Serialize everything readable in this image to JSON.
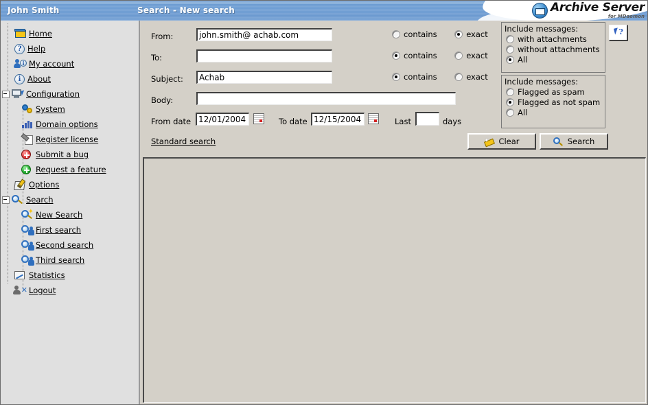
{
  "header": {
    "user": "John Smith",
    "title": "Search - New search",
    "logo_main": "Archive Server",
    "logo_sub": "for MDaemon",
    "logo_icon": "archive-mail-icon"
  },
  "sidebar": {
    "items": [
      {
        "label": "Home",
        "icon": "home-icon",
        "level": 0,
        "toggle": "none"
      },
      {
        "label": "Help",
        "icon": "help-question-icon",
        "level": 0,
        "toggle": "none"
      },
      {
        "label": "My account",
        "icon": "user-info-icon",
        "level": 0,
        "toggle": "none"
      },
      {
        "label": "About",
        "icon": "info-icon",
        "level": 0,
        "toggle": "none"
      },
      {
        "label": "Configuration",
        "icon": "computer-icon",
        "level": 0,
        "toggle": "minus"
      },
      {
        "label": "System",
        "icon": "gears-icon",
        "level": 1,
        "toggle": "none"
      },
      {
        "label": "Domain options",
        "icon": "bar-chart-icon",
        "level": 1,
        "toggle": "none"
      },
      {
        "label": "Register license",
        "icon": "license-pen-icon",
        "level": 1,
        "toggle": "none"
      },
      {
        "label": "Submit a bug",
        "icon": "plus-red-icon",
        "level": 1,
        "toggle": "none"
      },
      {
        "label": "Request a feature",
        "icon": "plus-green-icon",
        "level": 1,
        "toggle": "none"
      },
      {
        "label": "Options",
        "icon": "options-pencil-icon",
        "level": 0,
        "toggle": "none"
      },
      {
        "label": "Search",
        "icon": "magnifier-icon",
        "level": 0,
        "toggle": "minus"
      },
      {
        "label": "New Search",
        "icon": "new-search-icon",
        "level": 1,
        "toggle": "none"
      },
      {
        "label": "First search",
        "icon": "user-search-icon",
        "level": 1,
        "toggle": "none"
      },
      {
        "label": "Second search",
        "icon": "user-search-icon",
        "level": 1,
        "toggle": "none"
      },
      {
        "label": "Third search",
        "icon": "user-search-icon",
        "level": 1,
        "toggle": "none"
      },
      {
        "label": "Statistics",
        "icon": "statistics-icon",
        "level": 0,
        "toggle": "none"
      },
      {
        "label": "Logout",
        "icon": "logout-icon",
        "level": 0,
        "toggle": "none"
      }
    ]
  },
  "form": {
    "fields": {
      "from": {
        "label": "From:",
        "value": "john.smith@ achab.com",
        "placeholder": ""
      },
      "to": {
        "label": "To:",
        "value": "",
        "placeholder": ""
      },
      "subject": {
        "label": "Subject:",
        "value": "Achab",
        "placeholder": ""
      },
      "body": {
        "label": "Body:",
        "value": "",
        "placeholder": ""
      }
    },
    "match_options": {
      "contains_label": "contains",
      "exact_label": "exact",
      "rows": [
        {
          "field": "from",
          "selected": "exact"
        },
        {
          "field": "to",
          "selected": "contains"
        },
        {
          "field": "subject",
          "selected": "contains"
        }
      ]
    },
    "dates": {
      "from_label": "From date",
      "from_value": "12/01/2004",
      "to_label": "To date",
      "to_value": "12/15/2004",
      "calendar_icon": "calendar-icon"
    },
    "last_days": {
      "prefix_label": "Last",
      "value": "",
      "suffix_label": "days"
    },
    "standard_search_link": "Standard search",
    "attachments_group": {
      "legend": "Include messages:",
      "options": [
        {
          "label": "with attachments",
          "selected": false
        },
        {
          "label": "without attachments",
          "selected": false
        },
        {
          "label": "All",
          "selected": true
        }
      ]
    },
    "spam_group": {
      "legend": "Include messages:",
      "options": [
        {
          "label": "Flagged as spam",
          "selected": false
        },
        {
          "label": "Flagged as not spam",
          "selected": true
        },
        {
          "label": "All",
          "selected": false
        }
      ]
    },
    "buttons": {
      "clear": {
        "label": "Clear",
        "icon": "eraser-icon"
      },
      "search": {
        "label": "Search",
        "icon": "magnifier-icon"
      }
    },
    "help_button": {
      "icon": "help-cursor-icon"
    }
  },
  "results": {
    "content": ""
  }
}
